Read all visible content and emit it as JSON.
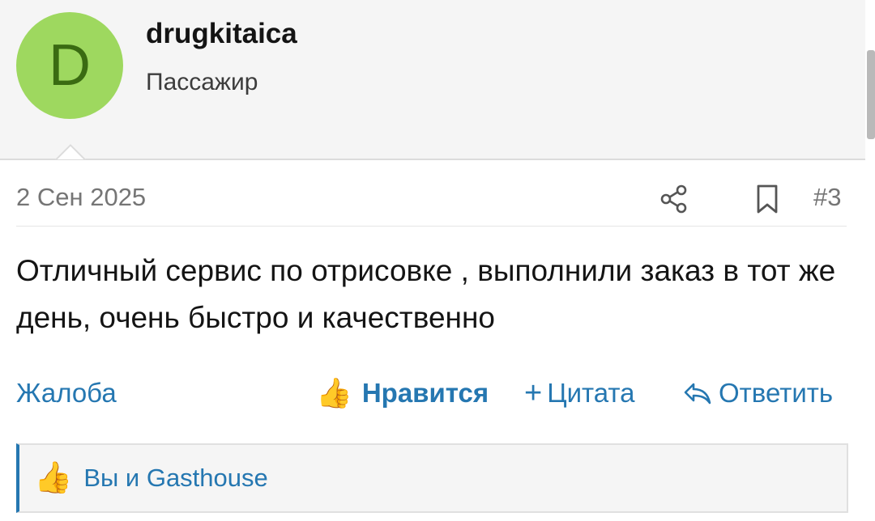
{
  "user": {
    "avatar_letter": "D",
    "name": "drugkitaica",
    "role": "Пассажир"
  },
  "post": {
    "date": "2 Сен 2025",
    "number": "#3",
    "body": "Отличный сервис по отрисовке , выполнили заказ в тот же день, очень быстро и качественно"
  },
  "actions": {
    "report": "Жалоба",
    "like": "Нравится",
    "quote_plus": "+",
    "quote": "Цитата",
    "reply": "Ответить"
  },
  "likes": {
    "text": "Вы и Gasthouse"
  },
  "icons": {
    "share": "share-icon",
    "bookmark": "bookmark-icon",
    "thumbs_up": "thumbs-up-icon",
    "reply": "reply-arrow-icon"
  },
  "colors": {
    "accent": "#2577b1",
    "avatar_bg": "#9ed85f"
  }
}
